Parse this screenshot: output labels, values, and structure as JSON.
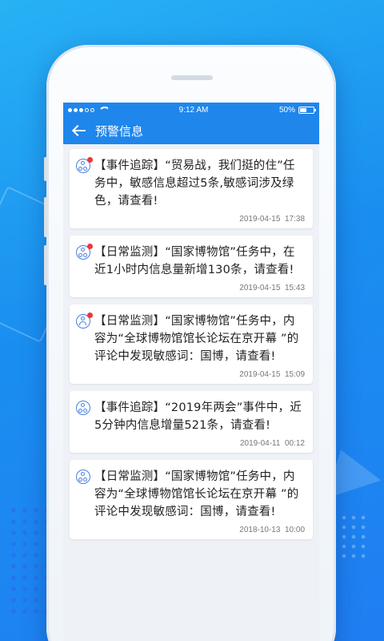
{
  "status_bar": {
    "time": "9:12 AM",
    "battery": "50%"
  },
  "navbar": {
    "title": "预警信息"
  },
  "alerts": [
    {
      "icon": "monitor-task-icon",
      "unread": true,
      "text": "【事件追踪】“贸易战，我们挺的住”任务中，敏感信息超过5条,敏感词涉及绿色，请查看!",
      "time": "2019-04-15  17:38"
    },
    {
      "icon": "monitor-task-icon",
      "unread": true,
      "text": "【日常监测】“国家博物馆”任务中，在近1小时内信息量新增130条，请查看!",
      "time": "2019-04-15  15:43"
    },
    {
      "icon": "user-task-icon",
      "unread": true,
      "text": "【日常监测】“国家博物馆”任务中，内容为“全球博物馆馆长论坛在京开幕 ”的评论中发现敏感词：国博，请查看!",
      "time": "2019-04-15  15:09"
    },
    {
      "icon": "monitor-task-icon",
      "unread": false,
      "text": "【事件追踪】“2019年两会”事件中，近5分钟内信息增量521条，请查看!",
      "time": "2019-04-11  00:12"
    },
    {
      "icon": "monitor-task-icon",
      "unread": false,
      "text": "【日常监测】“国家博物馆”任务中，内容为“全球博物馆馆长论坛在京开幕 ”的评论中发现敏感词：国博，请查看!",
      "time": "2018-10-13  10:00"
    }
  ]
}
